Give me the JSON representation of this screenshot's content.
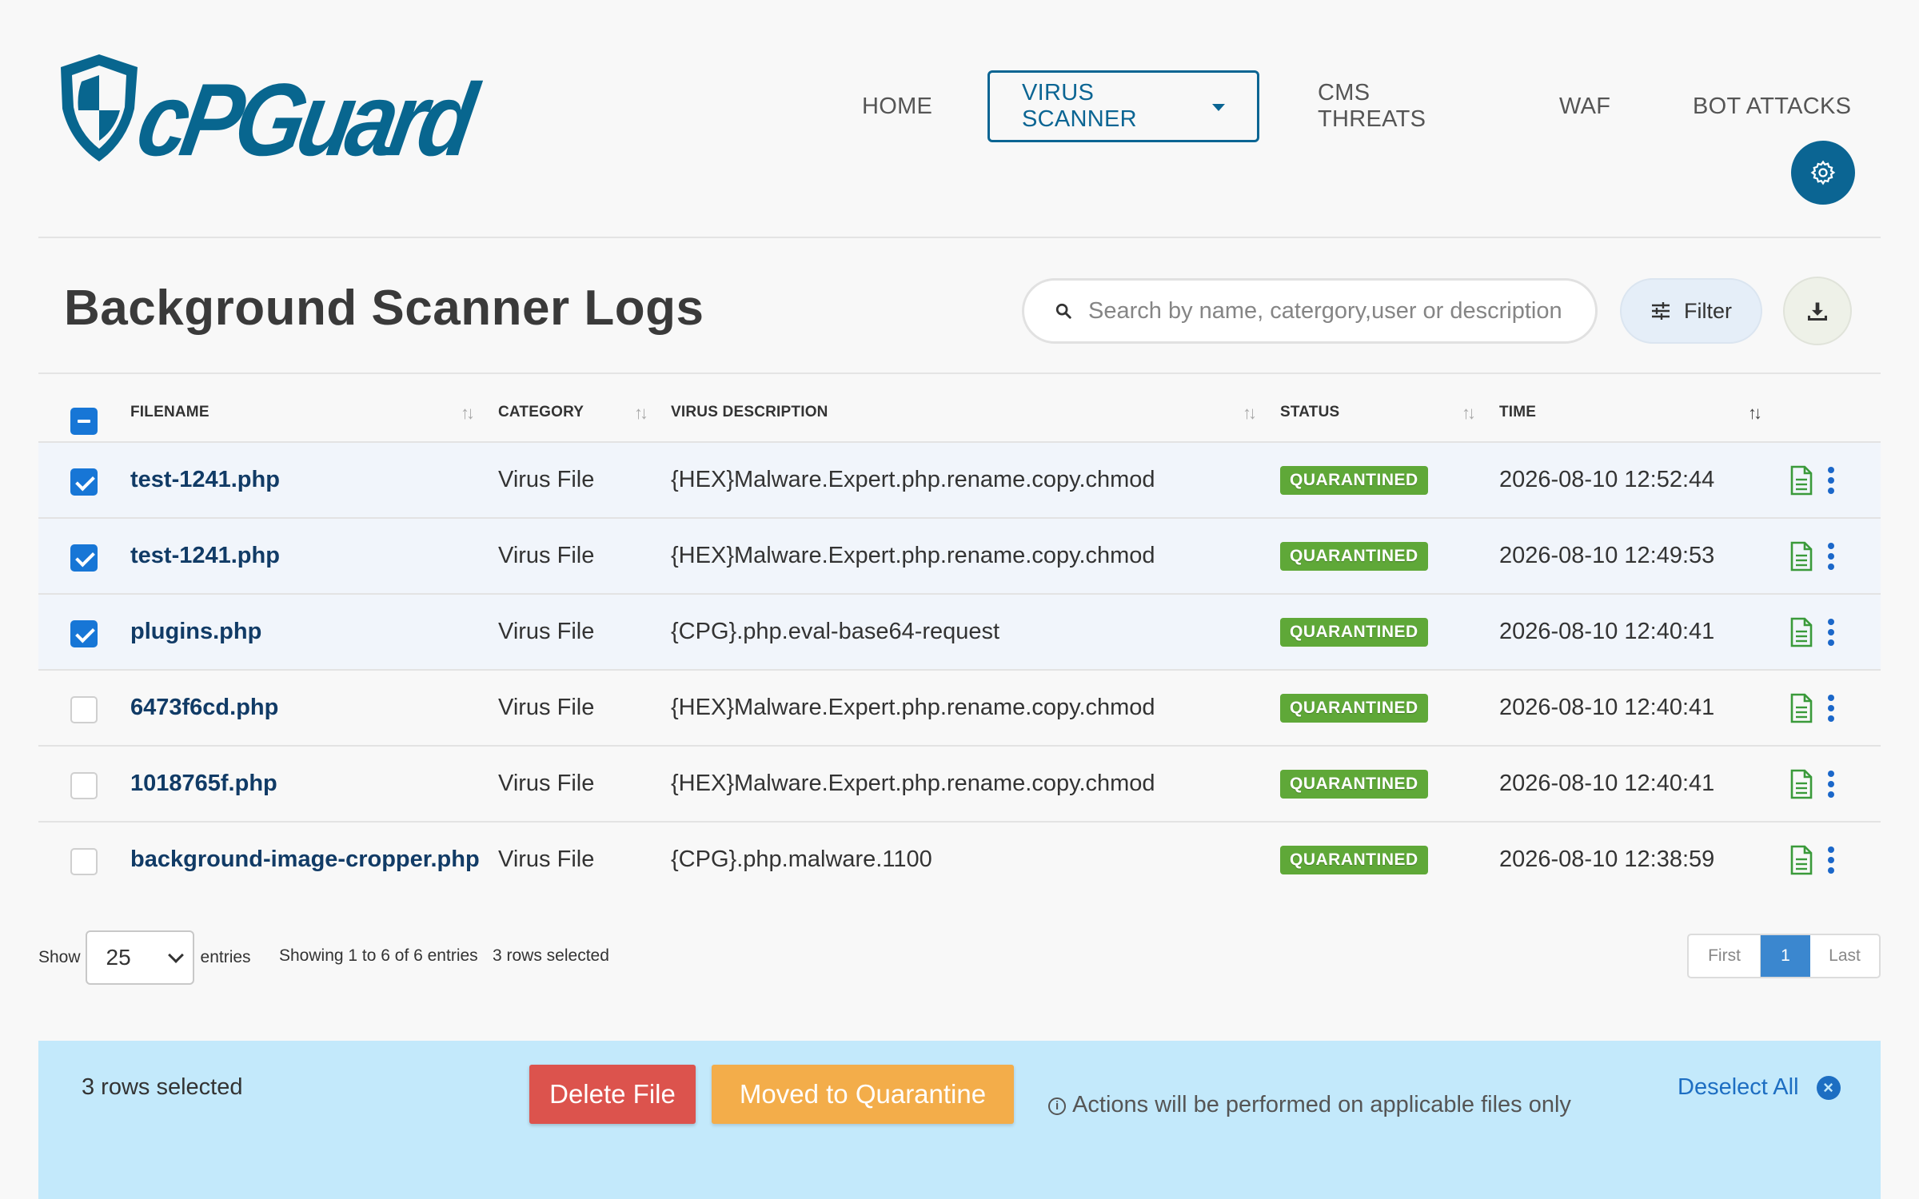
{
  "brand": {
    "logo_text": "cPGuard"
  },
  "nav": {
    "home": "HOME",
    "virus_scanner": "VIRUS SCANNER",
    "cms_threats": "CMS THREATS",
    "waf": "WAF",
    "bot_attacks": "BOT ATTACKS"
  },
  "page": {
    "title": "Background Scanner Logs",
    "search_placeholder": "Search by name, catergory,user or description",
    "filter_label": "Filter"
  },
  "table": {
    "headers": {
      "filename": "FILENAME",
      "category": "CATEGORY",
      "description": "VIRUS DESCRIPTION",
      "status": "STATUS",
      "time": "TIME"
    },
    "rows": [
      {
        "filename": "test-1241.php",
        "category": "Virus File",
        "description": "{HEX}Malware.Expert.php.rename.copy.chmod",
        "status": "QUARANTINED",
        "time": "2026-08-10 12:52:44",
        "selected": true
      },
      {
        "filename": "test-1241.php",
        "category": "Virus File",
        "description": "{HEX}Malware.Expert.php.rename.copy.chmod",
        "status": "QUARANTINED",
        "time": "2026-08-10 12:49:53",
        "selected": true
      },
      {
        "filename": "plugins.php",
        "category": "Virus File",
        "description": "{CPG}.php.eval-base64-request",
        "status": "QUARANTINED",
        "time": "2026-08-10 12:40:41",
        "selected": true
      },
      {
        "filename": "6473f6cd.php",
        "category": "Virus File",
        "description": "{HEX}Malware.Expert.php.rename.copy.chmod",
        "status": "QUARANTINED",
        "time": "2026-08-10 12:40:41",
        "selected": false
      },
      {
        "filename": "1018765f.php",
        "category": "Virus File",
        "description": "{HEX}Malware.Expert.php.rename.copy.chmod",
        "status": "QUARANTINED",
        "time": "2026-08-10 12:40:41",
        "selected": false
      },
      {
        "filename": "background-image-cropper.php",
        "category": "Virus File",
        "description": "{CPG}.php.malware.1100",
        "status": "QUARANTINED",
        "time": "2026-08-10 12:38:59",
        "selected": false
      }
    ]
  },
  "footer": {
    "show_label": "Show",
    "page_size": "25",
    "entries_label": "entries",
    "showing_text": "Showing 1 to 6 of 6 entries",
    "rows_selected_text": "3 rows selected",
    "pager": {
      "first": "First",
      "current": "1",
      "last": "Last"
    }
  },
  "bulk": {
    "count_text": "3 rows selected",
    "delete_label": "Delete File",
    "quarantine_label": "Moved to Quarantine",
    "info_text": "Actions will be performed on applicable files only",
    "deselect_label": "Deselect All"
  },
  "colors": {
    "brand": "#0b6593",
    "status_quarantined": "#5fa838",
    "selection": "#1776d6",
    "bulk_bar": "#c3e9fb",
    "delete": "#dc534d",
    "quarantine": "#f3ad4a"
  },
  "icons": {
    "settings": "gear-icon",
    "search": "search-icon",
    "filter": "sliders-icon",
    "download": "download-icon",
    "row_doc": "document-icon",
    "row_more": "more-vertical-icon",
    "deselect": "close-circle-icon",
    "info": "info-icon"
  }
}
